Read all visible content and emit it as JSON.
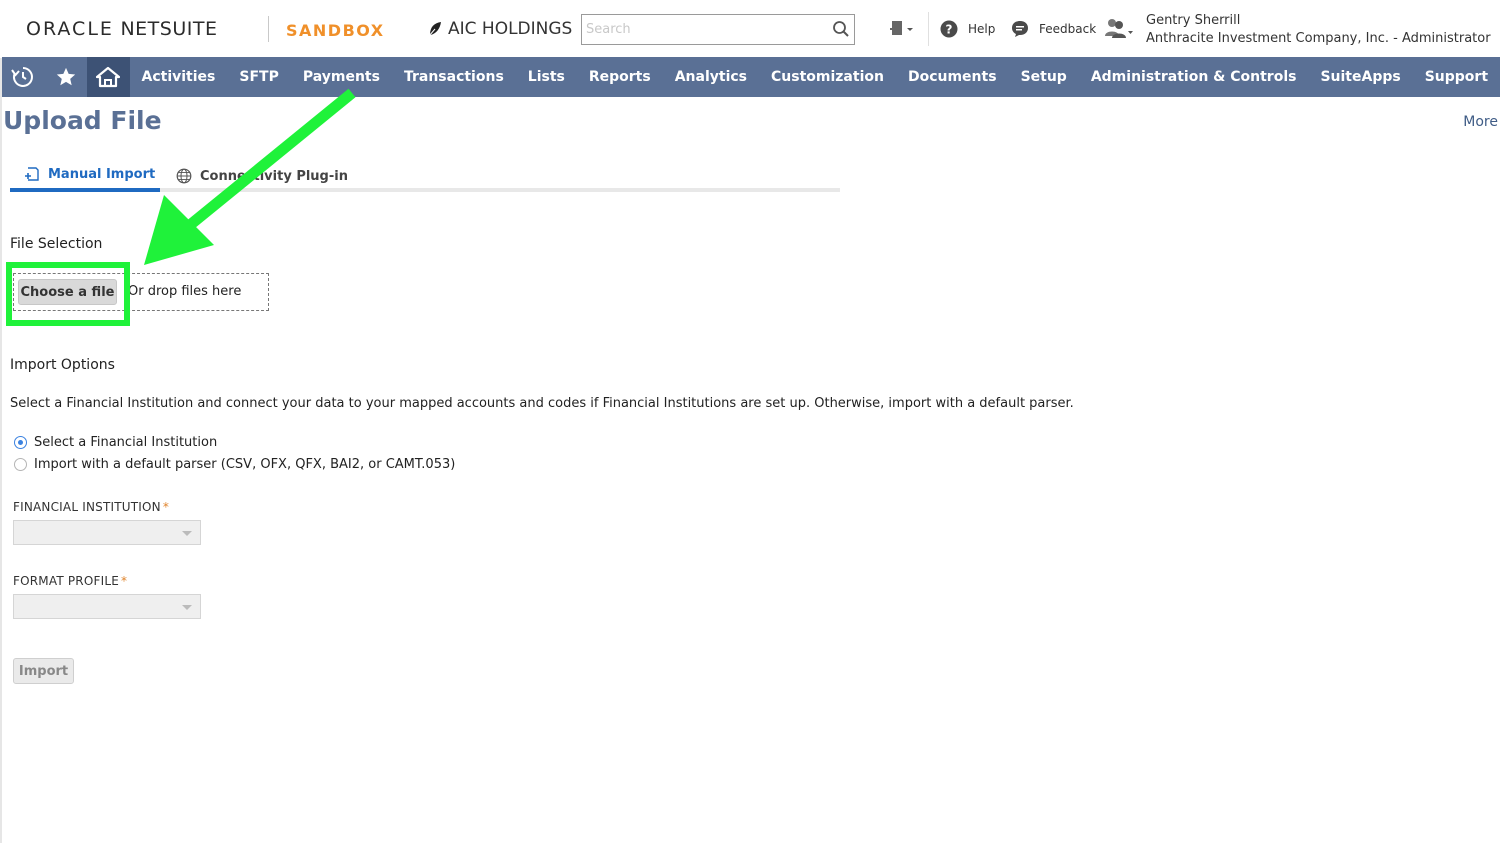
{
  "header": {
    "logo_oracle": "ORACLE",
    "logo_netsuite": "NETSUITE",
    "environment": "SANDBOX",
    "company": "AIC HOLDINGS",
    "search_placeholder": "Search",
    "help_label": "Help",
    "feedback_label": "Feedback",
    "user_name": "Gentry Sherrill",
    "user_role": "Anthracite Investment Company, Inc. - Administrator"
  },
  "nav": {
    "icons": [
      "recent-records-icon",
      "favorites-star-icon",
      "home-icon"
    ],
    "items": [
      "Activities",
      "SFTP",
      "Payments",
      "Transactions",
      "Lists",
      "Reports",
      "Analytics",
      "Customization",
      "Documents",
      "Setup",
      "Administration & Controls",
      "SuiteApps",
      "Support"
    ]
  },
  "page": {
    "title": "Upload File",
    "more_label": "More"
  },
  "tabs": [
    {
      "label": "Manual Import",
      "active": true,
      "icon": "import-icon"
    },
    {
      "label": "Connectivity Plug-in",
      "active": false,
      "icon": "globe-icon"
    }
  ],
  "file_selection": {
    "heading": "File Selection",
    "choose_label": "Choose a file",
    "drop_text": "Or drop files here"
  },
  "import_options": {
    "heading": "Import Options",
    "description": "Select a Financial Institution and connect your data to your mapped accounts and codes if Financial Institutions are set up. Otherwise, import with a default parser.",
    "radio_options": [
      {
        "label": "Select a Financial Institution",
        "checked": true
      },
      {
        "label": "Import with a default parser (CSV, OFX, QFX, BAI2, or CAMT.053)",
        "checked": false
      }
    ],
    "financial_institution_label": "FINANCIAL INSTITUTION",
    "format_profile_label": "FORMAT PROFILE",
    "required_marker": "*",
    "financial_institution_value": "",
    "format_profile_value": "",
    "import_label": "Import"
  },
  "colors": {
    "nav_bg": "#5a7095",
    "nav_active_bg": "#3d5275",
    "sandbox": "#f0902a",
    "tab_active": "#1f6ac1",
    "highlight": "#1ff23a"
  }
}
